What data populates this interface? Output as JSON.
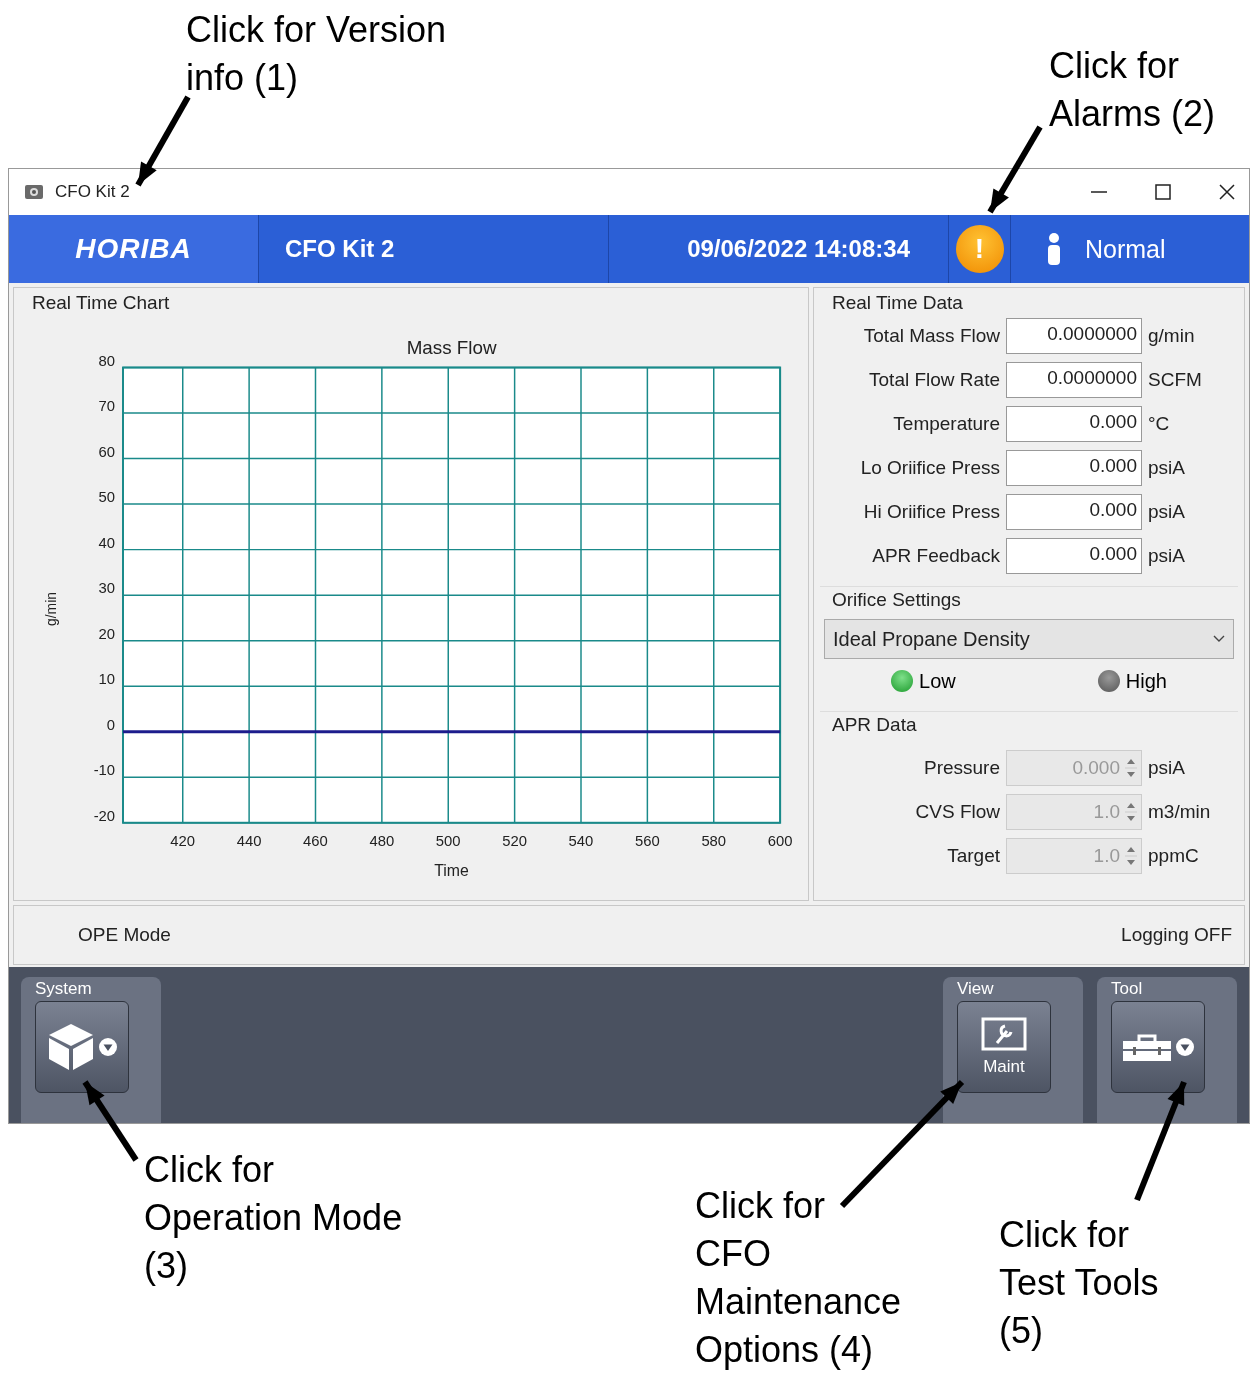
{
  "callouts": [
    {
      "lines": [
        "Click for Version",
        "info (1)"
      ]
    },
    {
      "lines": [
        "Click for",
        "Alarms (2)"
      ]
    },
    {
      "lines": [
        "Click for",
        "Operation Mode",
        "(3)"
      ]
    },
    {
      "lines": [
        "Click for",
        "CFO",
        "Maintenance",
        "Options (4)"
      ]
    },
    {
      "lines": [
        "Click for",
        "Test Tools",
        "(5)"
      ]
    }
  ],
  "window": {
    "title": "CFO Kit 2"
  },
  "header": {
    "logo": "HORIBA",
    "title": "CFO Kit 2",
    "datetime": "09/06/2022 14:08:34",
    "alarm": "!",
    "status": "Normal"
  },
  "chart_panel": {
    "title": "Real Time Chart",
    "chart_data": {
      "type": "line",
      "title": "Mass Flow",
      "xlabel": "Time",
      "ylabel": "g/min",
      "x": [
        402,
        600
      ],
      "series": [
        {
          "color": "#1c1c8c",
          "values": [
            0,
            0
          ]
        }
      ],
      "grid": true,
      "xlim": [
        402,
        600
      ],
      "ylim": [
        -20,
        80
      ],
      "xticks": [
        420,
        440,
        460,
        480,
        500,
        520,
        540,
        560,
        580,
        600
      ],
      "yticks": [
        -20,
        -10,
        0,
        10,
        20,
        30,
        40,
        50,
        60,
        70,
        80
      ]
    }
  },
  "real_time_data": {
    "title": "Real Time Data",
    "rows": [
      {
        "label": "Total Mass Flow",
        "value": "0.0000000",
        "unit": "g/min"
      },
      {
        "label": "Total Flow Rate",
        "value": "0.0000000",
        "unit": "SCFM"
      },
      {
        "label": "Temperature",
        "value": "0.000",
        "unit": "°C"
      },
      {
        "label": "Lo Oriifice Press",
        "value": "0.000",
        "unit": "psiA"
      },
      {
        "label": "Hi Oriifice Press",
        "value": "0.000",
        "unit": "psiA"
      },
      {
        "label": "APR Feedback",
        "value": "0.000",
        "unit": "psiA"
      }
    ]
  },
  "orifice_settings": {
    "title": "Orifice Settings",
    "dropdown": "Ideal Propane Density",
    "options": [
      {
        "label": "Low",
        "selected": true
      },
      {
        "label": "High",
        "selected": false
      }
    ]
  },
  "apr_data": {
    "title": "APR Data",
    "rows": [
      {
        "label": "Pressure",
        "value": "0.000",
        "unit": "psiA",
        "disabled": true
      },
      {
        "label": "CVS Flow",
        "value": "1.0",
        "unit": "m3/min",
        "disabled": true
      },
      {
        "label": "Target",
        "value": "1.0",
        "unit": "ppmC",
        "disabled": true
      }
    ]
  },
  "status_bar": {
    "mode": "OPE Mode",
    "logging": "Logging OFF"
  },
  "toolbar": [
    {
      "label": "System",
      "kind": "cube",
      "dropdown": true
    },
    {
      "label": "View",
      "kind": "maint",
      "text": "Maint",
      "dropdown": false
    },
    {
      "label": "Tool",
      "kind": "toolbox",
      "dropdown": true
    }
  ]
}
